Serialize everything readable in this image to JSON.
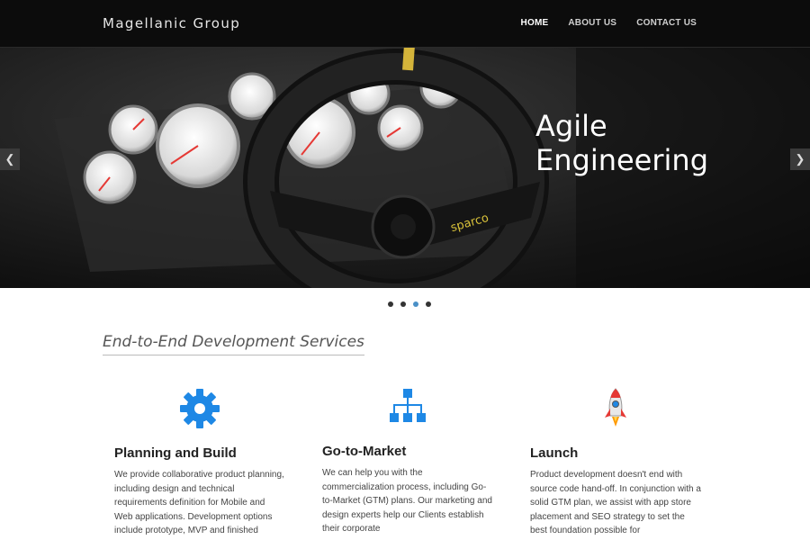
{
  "nav": {
    "brand": "Magellanic Group",
    "links": [
      {
        "label": "HOME"
      },
      {
        "label": "ABOUT US"
      },
      {
        "label": "CONTACT US"
      }
    ]
  },
  "hero": {
    "title_line1": "Agile",
    "title_line2": "Engineering",
    "prev_icon": "chevron-left-icon",
    "next_icon": "chevron-right-icon",
    "slide_count": 4,
    "active_slide": 3
  },
  "section": {
    "title": "End-to-End Development Services"
  },
  "services": [
    {
      "icon": "gear-icon",
      "title": "Planning and Build",
      "text": "We provide collaborative product planning, including design and technical requirements definition for Mobile and Web applications. Development options include prototype, MVP and finished"
    },
    {
      "icon": "sitemap-icon",
      "title": "Go-to-Market",
      "text": "We can help you with the commercialization process, including Go-to-Market (GTM) plans. Our marketing and design experts help our Clients establish their corporate"
    },
    {
      "icon": "rocket-icon",
      "title": "Launch",
      "text": "Product development doesn't end with source code hand-off. In conjunction with a solid GTM plan, we assist with app store placement and SEO strategy to set the best foundation possible for"
    }
  ],
  "colors": {
    "accent": "#1e88e5",
    "nav_bg": "#0c0c0c"
  }
}
